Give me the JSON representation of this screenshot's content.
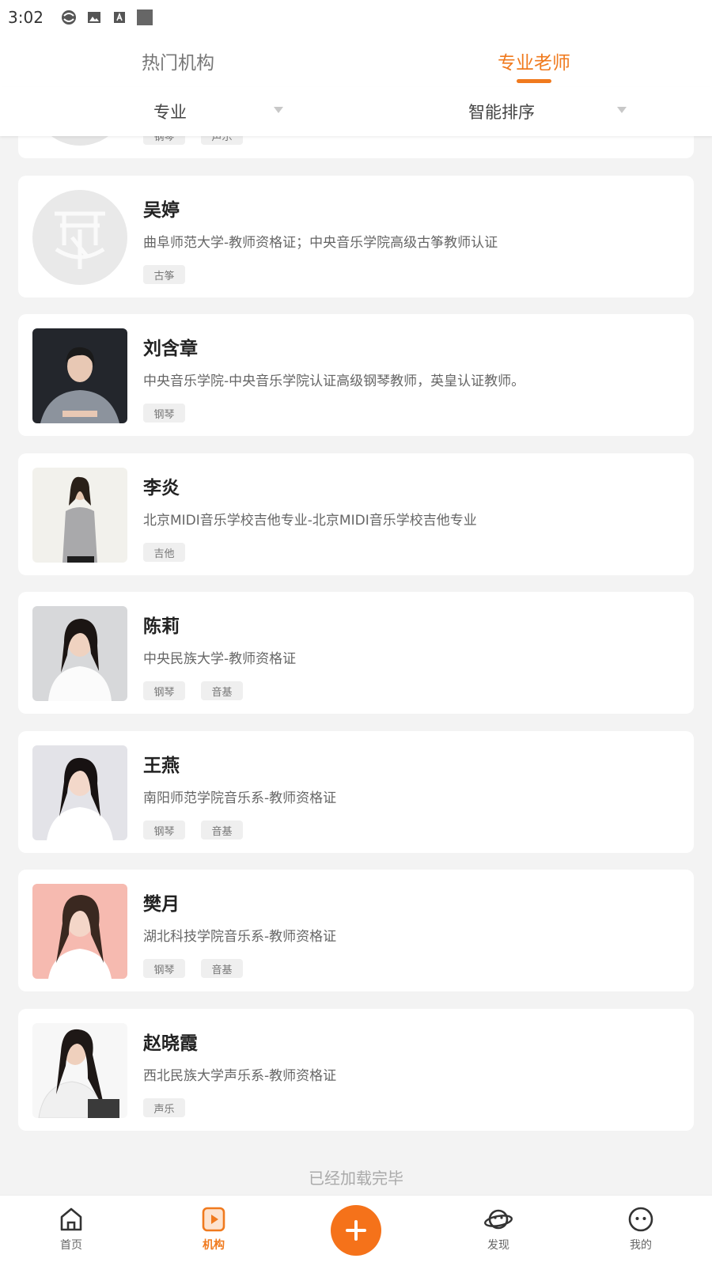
{
  "status_bar": {
    "time": "3:02"
  },
  "tabs": {
    "hot": "热门机构",
    "teacher": "专业老师"
  },
  "filters": {
    "major": "专业",
    "sort": "智能排序"
  },
  "partial_card": {
    "tags": [
      "钢琴",
      "声乐"
    ]
  },
  "teachers": [
    {
      "name": "吴婷",
      "desc": "曲阜师范大学-教师资格证；中央音乐学院高级古筝教师认证",
      "tags": [
        "古筝"
      ]
    },
    {
      "name": "刘含章",
      "desc": "中央音乐学院-中央音乐学院认证高级钢琴教师，英皇认证教师。",
      "tags": [
        "钢琴"
      ]
    },
    {
      "name": "李炎",
      "desc": "北京MIDI音乐学校吉他专业-北京MIDI音乐学校吉他专业",
      "tags": [
        "吉他"
      ]
    },
    {
      "name": "陈莉",
      "desc": "中央民族大学-教师资格证",
      "tags": [
        "钢琴",
        "音基"
      ]
    },
    {
      "name": "王燕",
      "desc": "南阳师范学院音乐系-教师资格证",
      "tags": [
        "钢琴",
        "音基"
      ]
    },
    {
      "name": "樊月",
      "desc": "湖北科技学院音乐系-教师资格证",
      "tags": [
        "钢琴",
        "音基"
      ]
    },
    {
      "name": "赵晓霞",
      "desc": "西北民族大学声乐系-教师资格证",
      "tags": [
        "声乐"
      ]
    }
  ],
  "footer": {
    "loaded": "已经加载完毕"
  },
  "nav": {
    "home": "首页",
    "org": "机构",
    "discover": "发现",
    "mine": "我的"
  },
  "colors": {
    "accent": "#f07a1e",
    "background": "#f3f3f3"
  }
}
